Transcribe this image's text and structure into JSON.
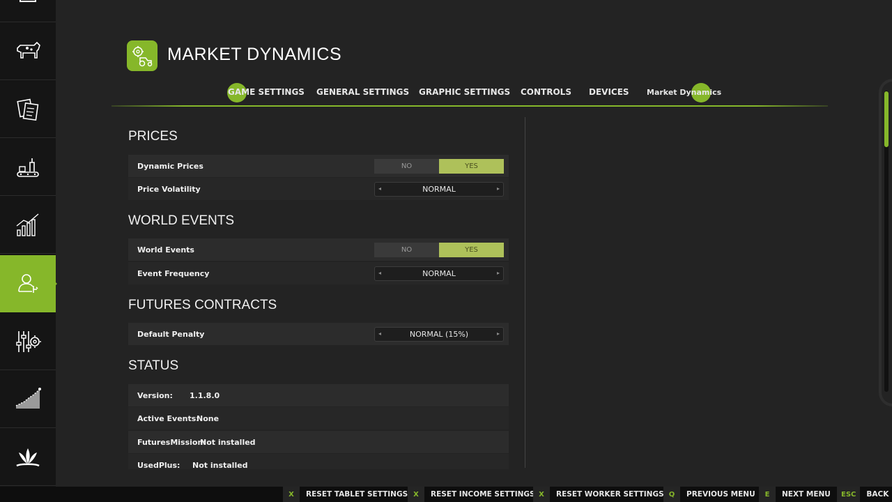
{
  "header": {
    "title": "MARKET DYNAMICS",
    "logo_icon": "tractor-gears-icon",
    "accent_color": "#86b72a"
  },
  "sidebar": {
    "items": [
      {
        "icon": "building-icon",
        "active": false
      },
      {
        "icon": "cow-icon",
        "active": false
      },
      {
        "icon": "documents-icon",
        "active": false
      },
      {
        "icon": "production-icon",
        "active": false
      },
      {
        "icon": "statistics-icon",
        "active": false
      },
      {
        "icon": "worker-icon",
        "active": true
      },
      {
        "icon": "settings-sliders-icon",
        "active": false
      },
      {
        "icon": "growth-chart-icon",
        "active": false
      },
      {
        "icon": "crop-icon",
        "active": false
      }
    ]
  },
  "tabs": [
    {
      "label": "GAME SETTINGS"
    },
    {
      "label": "GENERAL SETTINGS"
    },
    {
      "label": "GRAPHIC SETTINGS"
    },
    {
      "label": "CONTROLS"
    },
    {
      "label": "DEVICES"
    },
    {
      "label": "Market Dynamics"
    }
  ],
  "sections": {
    "prices": {
      "title": "PRICES",
      "dynamic_prices": {
        "label": "Dynamic Prices",
        "no": "NO",
        "yes": "YES"
      },
      "price_volatility": {
        "label": "Price Volatility",
        "value": "NORMAL"
      }
    },
    "world_events": {
      "title": "WORLD EVENTS",
      "world_events": {
        "label": "World Events",
        "no": "NO",
        "yes": "YES"
      },
      "event_frequency": {
        "label": "Event Frequency",
        "value": "NORMAL"
      }
    },
    "futures": {
      "title": "FUTURES CONTRACTS",
      "default_penalty": {
        "label": "Default Penalty",
        "value": "NORMAL (15%)"
      }
    },
    "status": {
      "title": "STATUS",
      "version": {
        "label": "Version:",
        "value": "1.1.8.0"
      },
      "active_events": {
        "label": "Active Events:",
        "value": "None"
      },
      "futures_mission": {
        "label": "FuturesMission:",
        "value": "Not installed"
      },
      "used_plus": {
        "label": "UsedPlus:",
        "value": "Not installed"
      }
    }
  },
  "bottom_bar": [
    {
      "key": "X",
      "label": "RESET TABLET SETTINGS"
    },
    {
      "key": "X",
      "label": "RESET INCOME SETTINGS"
    },
    {
      "key": "X",
      "label": "RESET WORKER SETTINGS"
    },
    {
      "key": "Q",
      "label": "PREVIOUS MENU"
    },
    {
      "key": "E",
      "label": "NEXT MENU"
    },
    {
      "key": "ESC",
      "label": "BACK"
    }
  ]
}
